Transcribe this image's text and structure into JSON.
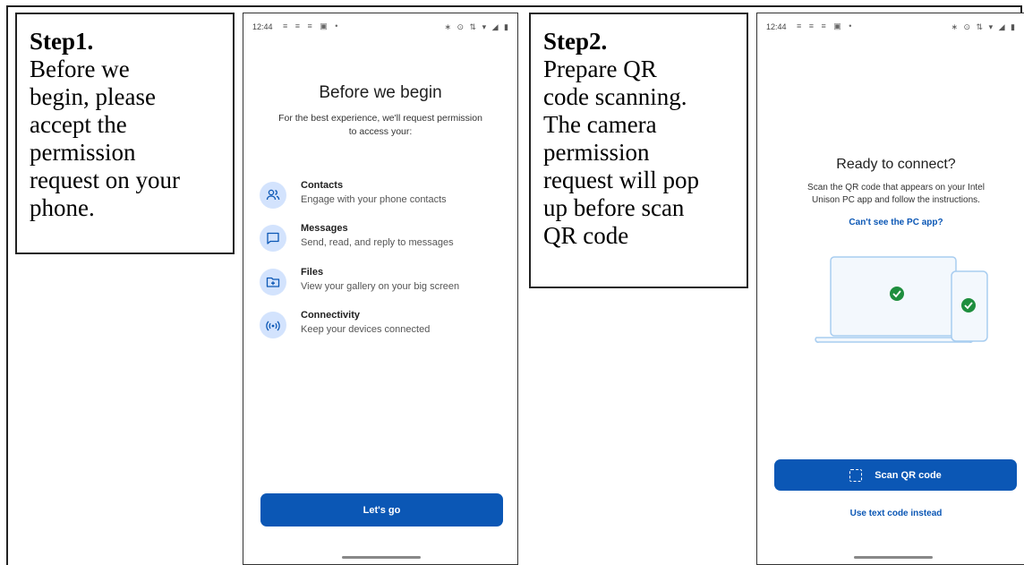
{
  "step1": {
    "title": "Step1.",
    "lines": [
      "Before we",
      "begin, please",
      "accept the",
      "permission",
      "request on your",
      "phone."
    ]
  },
  "step2": {
    "title": "Step2.",
    "lines": [
      "Prepare QR",
      "code scanning.",
      "The camera",
      "permission",
      "request will pop",
      "up before scan",
      "QR code"
    ]
  },
  "phone1": {
    "time": "12:44",
    "title": "Before we begin",
    "subtitle_lines": [
      "For the best experience, we'll request permission",
      "to access your:"
    ],
    "permissions": [
      {
        "icon": "contacts-icon",
        "title": "Contacts",
        "desc": "Engage with your phone contacts"
      },
      {
        "icon": "messages-icon",
        "title": "Messages",
        "desc": "Send, read, and reply to messages"
      },
      {
        "icon": "files-icon",
        "title": "Files",
        "desc": "View your gallery on your big screen"
      },
      {
        "icon": "connectivity-icon",
        "title": "Connectivity",
        "desc": "Keep your devices connected"
      }
    ],
    "button": "Let's go"
  },
  "phone2": {
    "time": "12:44",
    "title": "Ready to connect?",
    "subtitle_lines": [
      "Scan the QR code that appears on your Intel",
      "Unison PC app and follow the instructions."
    ],
    "help_link": "Can't see the PC app?",
    "scan_button": "Scan QR code",
    "alt_link": "Use text code instead"
  },
  "colors": {
    "accent": "#0b57b5",
    "icon_bg": "#d3e3fd",
    "check": "#1e8e3e"
  }
}
